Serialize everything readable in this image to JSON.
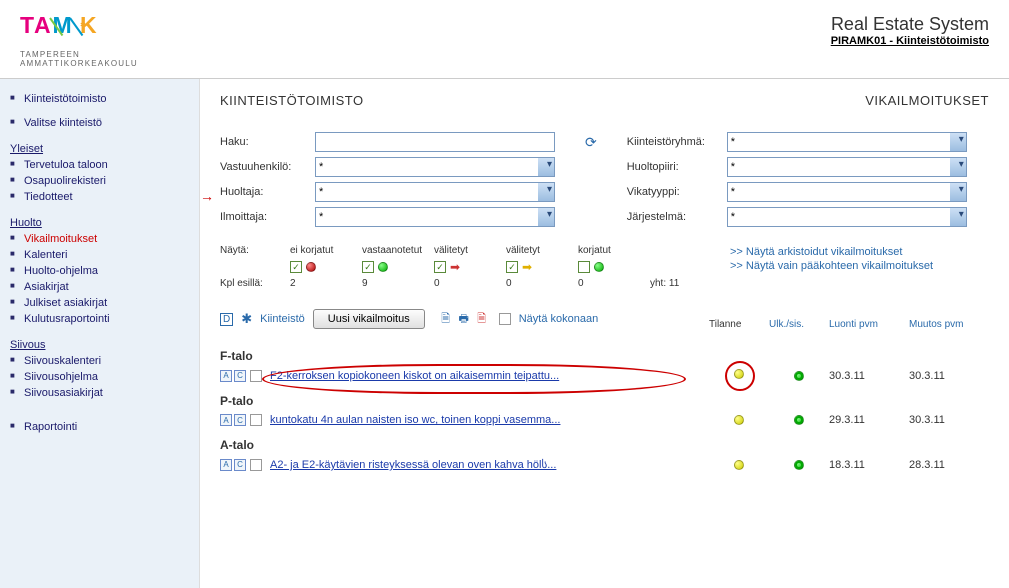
{
  "header": {
    "logo_sub1": "TAMPEREEN",
    "logo_sub2": "AMMATTIKORKEAKOULU",
    "sys_title": "Real Estate System",
    "sys_sub": "PIRAMK01 - Kiinteistötoimisto"
  },
  "sidebar": {
    "top": [
      {
        "label": "Kiinteistötoimisto"
      },
      {
        "label": "Valitse kiinteistö"
      }
    ],
    "groups": [
      {
        "head": "Yleiset",
        "items": [
          "Tervetuloa taloon",
          "Osapuolirekisteri",
          "Tiedotteet"
        ]
      },
      {
        "head": "Huolto",
        "items": [
          "Vikailmoitukset",
          "Kalenteri",
          "Huolto-ohjelma",
          "Asiakirjat",
          "Julkiset asiakirjat",
          "Kulutusraportointi"
        ],
        "active": 0
      },
      {
        "head": "Siivous",
        "items": [
          "Siivouskalenteri",
          "Siivousohjelma",
          "Siivousasiakirjat"
        ]
      }
    ],
    "bottom": [
      {
        "label": "Raportointi"
      }
    ]
  },
  "main": {
    "title_left": "KIINTEISTÖTOIMISTO",
    "title_right": "VIKAILMOITUKSET",
    "filters": {
      "left": [
        {
          "label": "Haku:",
          "type": "text",
          "value": ""
        },
        {
          "label": "Vastuuhenkilö:",
          "type": "select",
          "value": "*"
        },
        {
          "label": "Huoltaja:",
          "type": "select",
          "value": "*",
          "arrow": true
        },
        {
          "label": "Ilmoittaja:",
          "type": "select",
          "value": "*"
        }
      ],
      "right": [
        {
          "label": "Kiinteistöryhmä:",
          "type": "select",
          "value": "*"
        },
        {
          "label": "Huoltopiiri:",
          "type": "select",
          "value": "*"
        },
        {
          "label": "Vikatyyppi:",
          "type": "select",
          "value": "*"
        },
        {
          "label": "Järjestelmä:",
          "type": "select",
          "value": "*"
        }
      ]
    },
    "status": {
      "nayta": "Näytä:",
      "kpl": "Kpl esillä:",
      "cols": [
        "ei korjatut",
        "vastaanotetut",
        "välitetyt",
        "välitetyt",
        "korjatut"
      ],
      "counts": [
        "2",
        "9",
        "0",
        "0",
        "0"
      ],
      "checked": [
        true,
        true,
        true,
        true,
        false
      ],
      "total_label": "yht:",
      "total": "11",
      "links": [
        ">> Näytä arkistoidut vikailmoitukset",
        ">> Näytä vain pääkohteen vikailmoitukset"
      ]
    },
    "toolbar": {
      "kiinteisto": "Kiinteistö",
      "new_btn": "Uusi vikailmoitus",
      "show_all": "Näytä kokonaan"
    },
    "columns": [
      "Tilanne",
      "Ulk./sis.",
      "Luonti pvm",
      "Muutos pvm"
    ],
    "groups": [
      {
        "building": "F-talo",
        "rows": [
          {
            "title": "F2-kerroksen kopiokoneen kiskot on aikaisemmin teipattu...",
            "tilanne": "yellow",
            "ulk": "green",
            "luonti": "30.3.11",
            "muutos": "30.3.11",
            "highlight": true
          }
        ]
      },
      {
        "building": "P-talo",
        "rows": [
          {
            "title": "kuntokatu 4n aulan naisten iso wc, toinen koppi vasemma...",
            "tilanne": "yellow",
            "ulk": "green",
            "luonti": "29.3.11",
            "muutos": "30.3.11"
          }
        ]
      },
      {
        "building": "A-talo",
        "rows": [
          {
            "title": "A2- ja E2-käytävien risteyksessä olevan oven kahva hölს...",
            "tilanne": "yellow",
            "ulk": "green",
            "luonti": "18.3.11",
            "muutos": "28.3.11"
          }
        ]
      }
    ]
  }
}
